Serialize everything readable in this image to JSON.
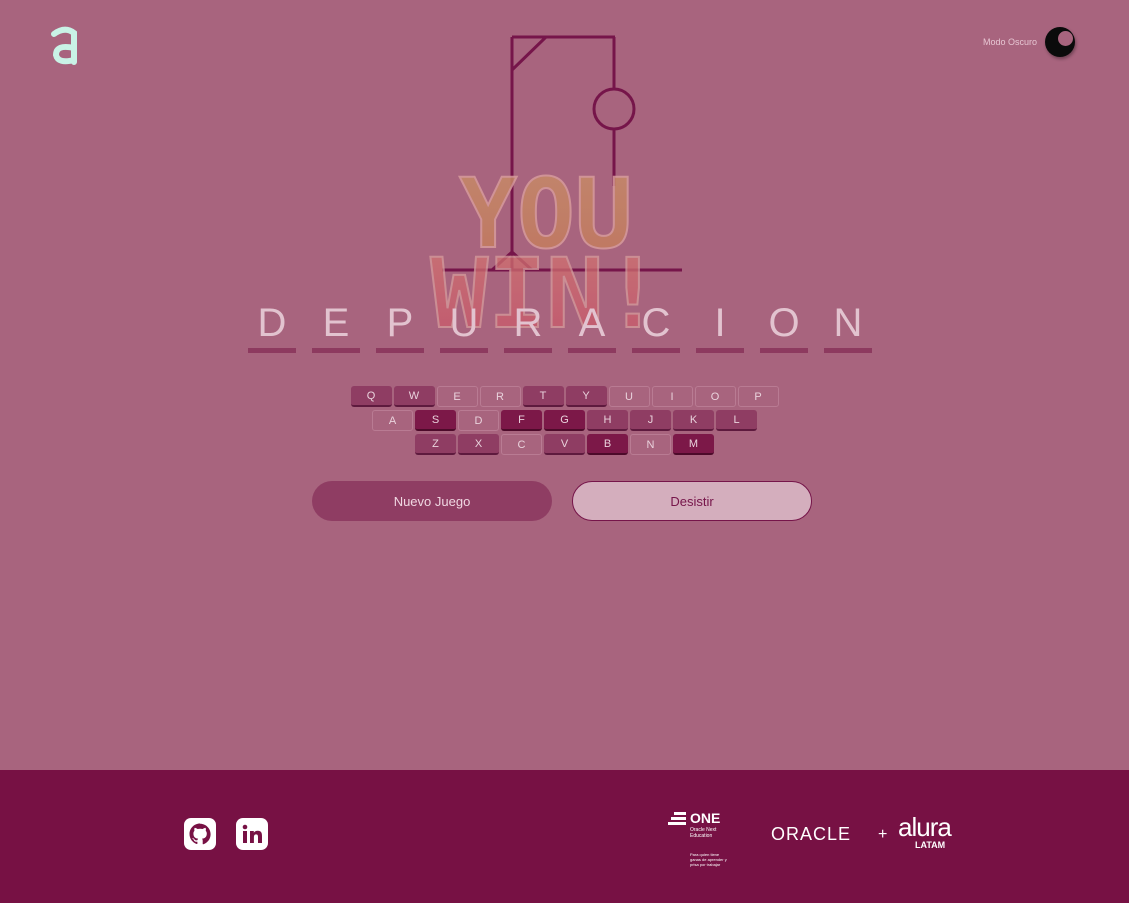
{
  "header": {
    "theme_label": "Modo Oscuro",
    "logo_icon": "alura-a-logo",
    "theme_icon": "moon-icon"
  },
  "game": {
    "result_text": "YOU WIN!",
    "word": [
      "D",
      "E",
      "P",
      "U",
      "R",
      "A",
      "C",
      "I",
      "O",
      "N"
    ],
    "keyboard": {
      "row1": [
        {
          "key": "Q",
          "state": "hit"
        },
        {
          "key": "W",
          "state": "hit"
        },
        {
          "key": "E",
          "state": "idle"
        },
        {
          "key": "R",
          "state": "idle"
        },
        {
          "key": "T",
          "state": "hit"
        },
        {
          "key": "Y",
          "state": "hit"
        },
        {
          "key": "U",
          "state": "idle"
        },
        {
          "key": "I",
          "state": "idle"
        },
        {
          "key": "O",
          "state": "idle"
        },
        {
          "key": "P",
          "state": "idle"
        }
      ],
      "row2": [
        {
          "key": "A",
          "state": "idle"
        },
        {
          "key": "S",
          "state": "used"
        },
        {
          "key": "D",
          "state": "idle"
        },
        {
          "key": "F",
          "state": "used"
        },
        {
          "key": "G",
          "state": "used"
        },
        {
          "key": "H",
          "state": "hit"
        },
        {
          "key": "J",
          "state": "hit"
        },
        {
          "key": "K",
          "state": "hit"
        },
        {
          "key": "L",
          "state": "hit"
        }
      ],
      "row3": [
        {
          "key": "Z",
          "state": "hit"
        },
        {
          "key": "X",
          "state": "hit"
        },
        {
          "key": "C",
          "state": "idle"
        },
        {
          "key": "V",
          "state": "hit"
        },
        {
          "key": "B",
          "state": "used"
        },
        {
          "key": "N",
          "state": "idle"
        },
        {
          "key": "M",
          "state": "used"
        }
      ]
    },
    "buttons": {
      "new_game": "Nuevo Juego",
      "give_up": "Desistir"
    }
  },
  "footer": {
    "github_icon": "github-icon",
    "linkedin_icon": "linkedin-icon",
    "one_title": "ONE",
    "one_subtitle": "Oracle Next Education",
    "one_tagline": "Para quien tiene ganas de aprender y prisa por trabajar",
    "oracle": "ORACLE",
    "plus": "+",
    "alura": "alura",
    "latam": "LATAM"
  },
  "colors": {
    "background": "#a8647e",
    "footer": "#771144",
    "accent": "#76154a",
    "logo": "#c9f2e6"
  }
}
